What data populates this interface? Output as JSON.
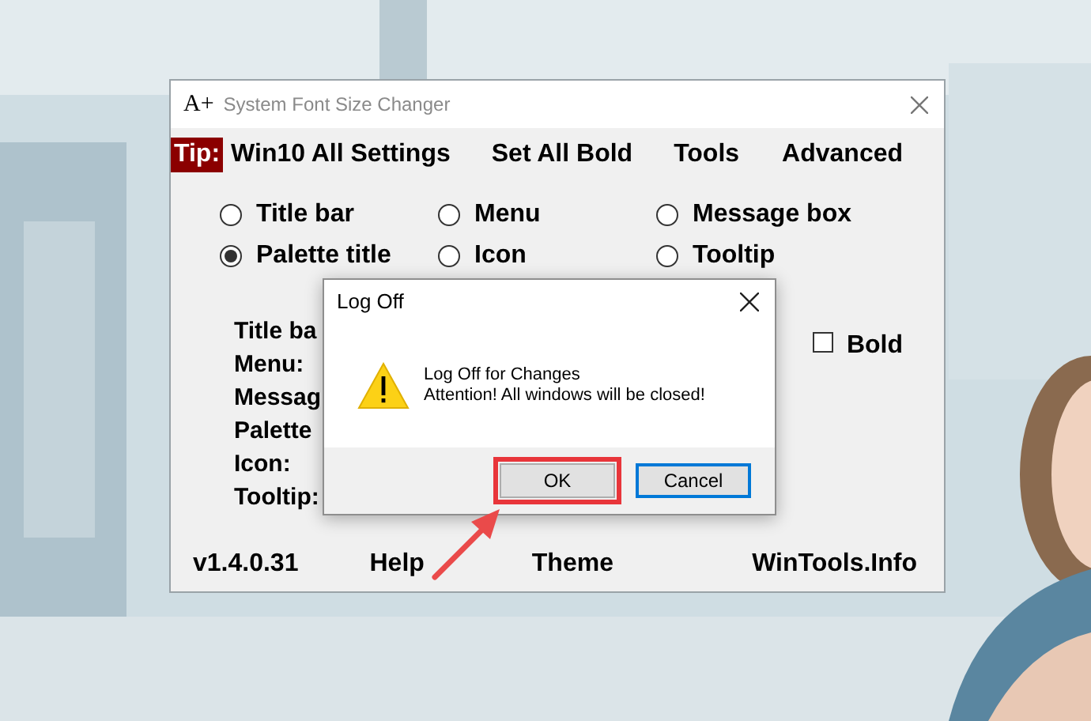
{
  "window": {
    "logo": "A+",
    "title": "System Font Size Changer"
  },
  "menu": {
    "tip": "Tip:",
    "items": [
      "Win10 All Settings",
      "Set All Bold",
      "Tools",
      "Advanced"
    ]
  },
  "options": [
    {
      "label": "Title bar",
      "selected": false
    },
    {
      "label": "Menu",
      "selected": false
    },
    {
      "label": "Message box",
      "selected": false
    },
    {
      "label": "Palette title",
      "selected": true
    },
    {
      "label": "Icon",
      "selected": false
    },
    {
      "label": "Tooltip",
      "selected": false
    }
  ],
  "labels": [
    "Title ba",
    "Menu:",
    "Messag",
    "Palette",
    "Icon:",
    "Tooltip:"
  ],
  "bold_checkbox": {
    "label": "Bold",
    "checked": false
  },
  "footer": [
    "v1.4.0.31",
    "Help",
    "Theme",
    "WinTools.Info"
  ],
  "dialog": {
    "title": "Log Off",
    "message": [
      "Log Off for Changes",
      "Attention! All windows will be closed!"
    ],
    "buttons": [
      {
        "label": "OK",
        "focused": false,
        "highlighted": true
      },
      {
        "label": "Cancel",
        "focused": true,
        "highlighted": false
      }
    ]
  }
}
